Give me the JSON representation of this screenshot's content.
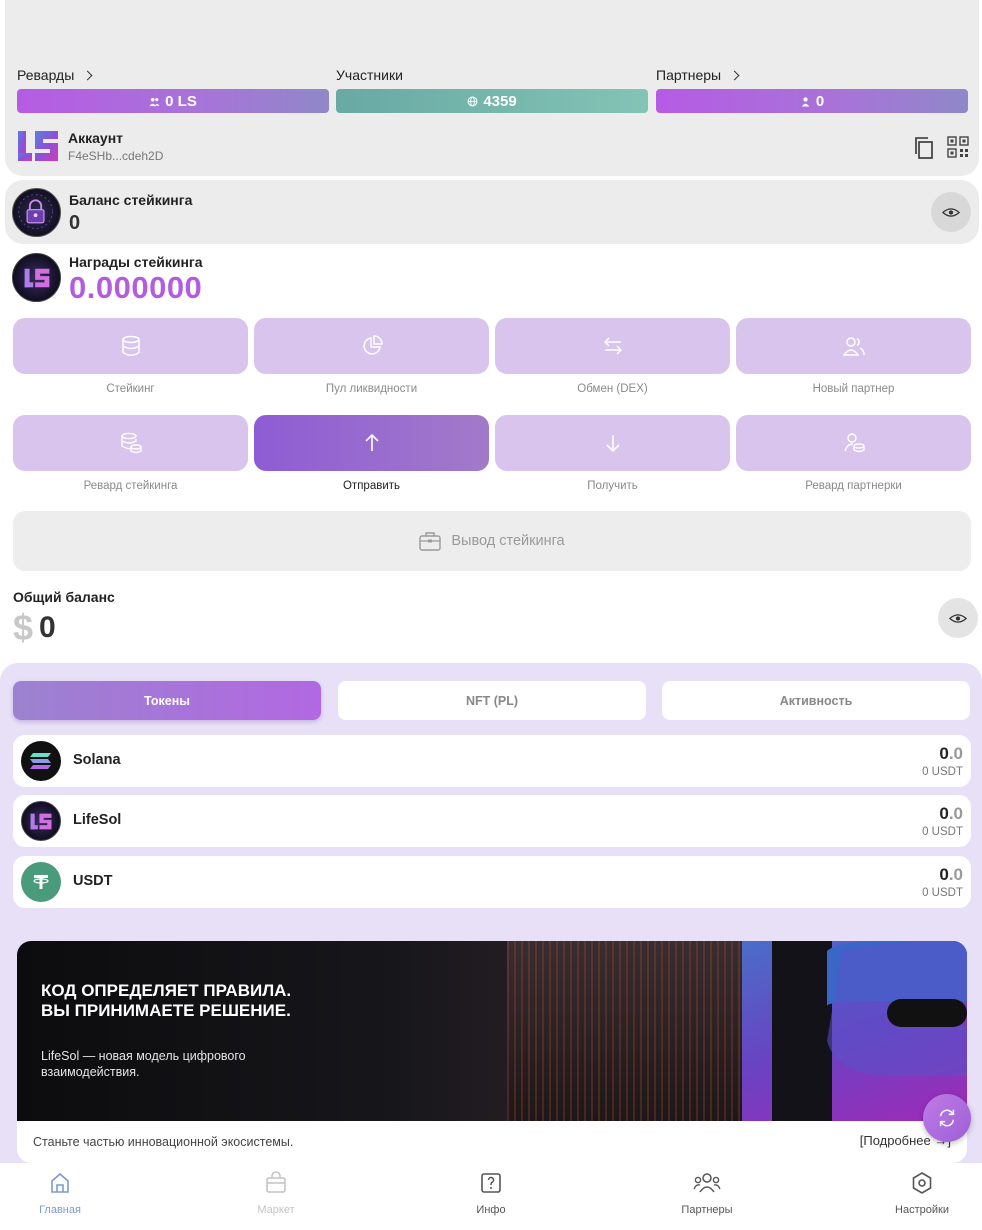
{
  "stats": {
    "rewards_label": "Реварды",
    "rewards_value": "0 LS",
    "participants_label": "Участники",
    "participants_value": "4359",
    "partners_label": "Партнеры",
    "partners_value": "0"
  },
  "account": {
    "title": "Аккаунт",
    "address": "F4eSHb...cdeh2D"
  },
  "staking": {
    "balance_label": "Баланс стейкинга",
    "balance_value": "0",
    "rewards_label": "Награды стейкинга",
    "rewards_value": "0.000000"
  },
  "actions": [
    {
      "label": "Стейкинг",
      "icon": "database-icon"
    },
    {
      "label": "Пул ликвидности",
      "icon": "pie-chart-icon"
    },
    {
      "label": "Обмен (DEX)",
      "icon": "swap-arrows-icon"
    },
    {
      "label": "Новый партнер",
      "icon": "users-icon"
    },
    {
      "label": "Ревард стейкинга",
      "icon": "coins-icon"
    },
    {
      "label": "Отправить",
      "icon": "arrow-up-icon"
    },
    {
      "label": "Получить",
      "icon": "arrow-down-icon"
    },
    {
      "label": "Ревард партнерки",
      "icon": "user-coins-icon"
    }
  ],
  "withdraw_label": "Вывод стейкинга",
  "total": {
    "label": "Общий баланс",
    "currency": "$",
    "value": "0"
  },
  "tabs": [
    "Токены",
    "NFT (PL)",
    "Активность"
  ],
  "tokens": [
    {
      "name": "Solana",
      "amount_int": "0",
      "amount_frac": ".0",
      "usd": "0 USDT"
    },
    {
      "name": "LifeSol",
      "amount_int": "0",
      "amount_frac": ".0",
      "usd": "0 USDT"
    },
    {
      "name": "USDT",
      "amount_int": "0",
      "amount_frac": ".0",
      "usd": "0 USDT"
    }
  ],
  "banner": {
    "headline": "КОД ОПРЕДЕЛЯЕТ ПРАВИЛА. ВЫ ПРИНИМАЕТЕ РЕШЕНИЕ.",
    "sub": "LifeSol — новая модель цифрового взаимодействия.",
    "footer": "Станьте частью инновационной экосистемы.",
    "more": "[Подробнее →]"
  },
  "nav": [
    {
      "label": "Главная",
      "icon": "home-icon"
    },
    {
      "label": "Маркет",
      "icon": "shopping-bag-icon"
    },
    {
      "label": "Инфо",
      "icon": "info-icon"
    },
    {
      "label": "Партнеры",
      "icon": "partners-icon"
    },
    {
      "label": "Настройки",
      "icon": "settings-icon"
    }
  ],
  "colors": {
    "accent": "#b45ce0",
    "teal": "#72b5ad",
    "tokens_bg": "#e8e0f7",
    "action_bg": "#d8c4ec"
  }
}
